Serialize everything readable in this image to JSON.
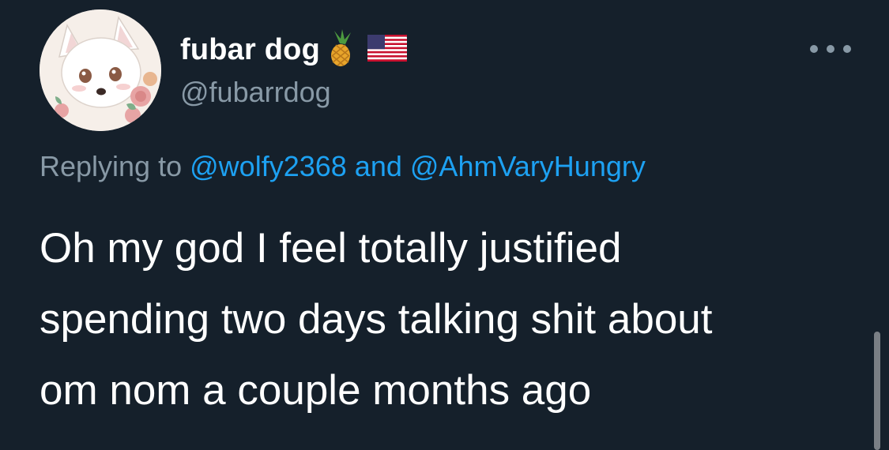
{
  "tweet": {
    "author": {
      "display_name": "fubar dog",
      "name_emojis": [
        "pineapple-emoji",
        "us-flag-emoji"
      ],
      "handle": "@fubarrdog",
      "avatar": "illustrated-white-dog-with-roses-avatar"
    },
    "more_icon": "more-horizontal-icon",
    "reply_context": {
      "prefix": "Replying to",
      "mention_1": "@wolfy2368",
      "conjunction": "and",
      "mention_2": "@AhmVaryHungry"
    },
    "text_lines": [
      "Oh my god I feel totally justified",
      "spending two days talking shit about",
      "om nom a couple months ago"
    ]
  },
  "colors": {
    "background": "#15202b",
    "primary_text": "#ffffff",
    "secondary_text": "#8899a6",
    "link": "#1da1f2"
  }
}
